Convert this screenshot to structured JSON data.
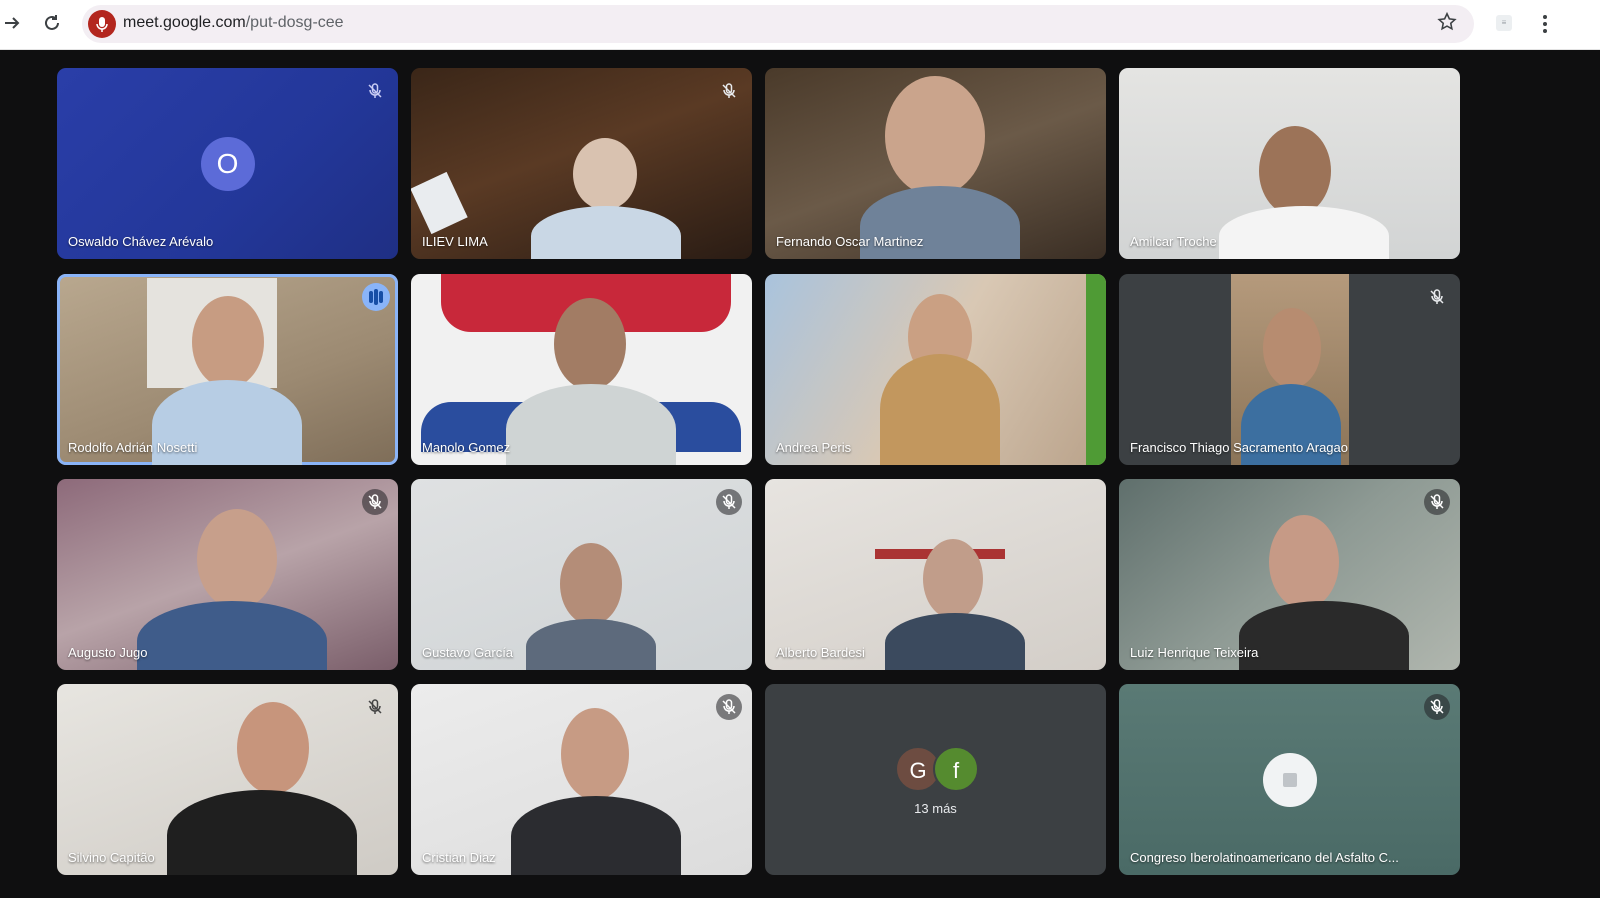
{
  "browser": {
    "url_host": "meet.google.com",
    "url_path": "/put-dosg-cee",
    "back_icon": "arrow-forward-icon",
    "reload_icon": "reload-icon",
    "bookmark_icon": "star-icon",
    "menu_icon": "more-vert-icon"
  },
  "meeting": {
    "participants": [
      {
        "name": "Oswaldo Chávez Arévalo",
        "mic": "muted",
        "avatar_letter": "O"
      },
      {
        "name": "ILIEV LIMA",
        "mic": "muted"
      },
      {
        "name": "Fernando Oscar Martinez",
        "mic": "on"
      },
      {
        "name": "Amilcar Troche",
        "mic": "on"
      },
      {
        "name": "Rodolfo Adrián Nosetti",
        "mic": "speaking"
      },
      {
        "name": "Manolo Gomez",
        "mic": "on"
      },
      {
        "name": "Andrea Peris",
        "mic": "on"
      },
      {
        "name": "Francisco Thiago Sacramento Aragao",
        "mic": "muted"
      },
      {
        "name": "Augusto Jugo",
        "mic": "muted"
      },
      {
        "name": "Gustavo García",
        "mic": "muted"
      },
      {
        "name": "Alberto Bardesi",
        "mic": "on"
      },
      {
        "name": "Luiz Henrique Teixeira",
        "mic": "muted"
      },
      {
        "name": "Silvino Capitão",
        "mic": "muted"
      },
      {
        "name": "Cristian Diaz",
        "mic": "muted"
      },
      {
        "name": "",
        "mic": "on"
      },
      {
        "name": "Congreso Iberolatinoamericano del Asfalto C...",
        "mic": "muted"
      }
    ],
    "more_tile": {
      "avatars": [
        {
          "letter": "G",
          "color": "#6d4c41"
        },
        {
          "letter": "f",
          "color": "#558b2f"
        }
      ],
      "label": "13 más"
    },
    "colors": {
      "speaking_ring": "#8ab4f8",
      "grid_background": "#0f0f10"
    }
  }
}
